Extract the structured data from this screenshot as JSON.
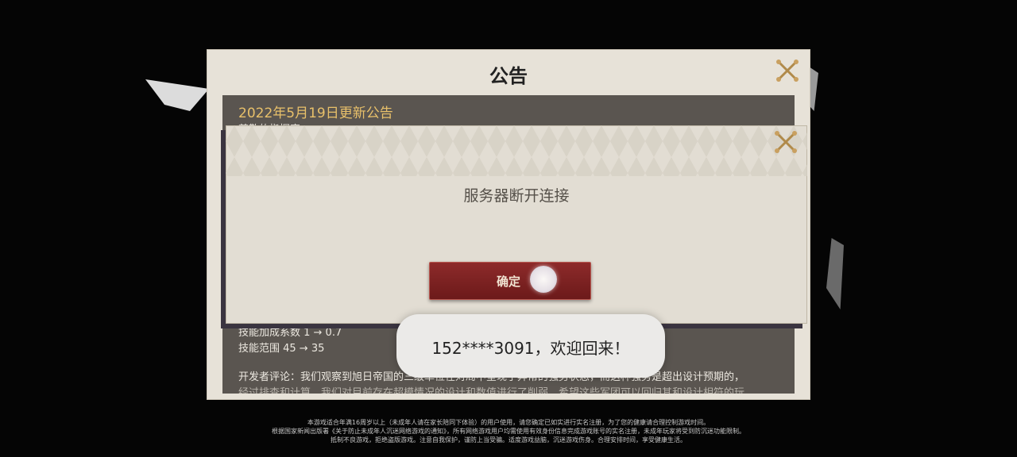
{
  "announcement": {
    "title": "公告",
    "date_heading": "2022年5月19日更新公告",
    "greeting": "尊敬的指挥官：",
    "lines": [
      "技能加成系数 1 → 0.7",
      "技能范围 45 → 35",
      "开发者评论：我们观察到旭日帝国的三级单位在对局中呈现了异常的强势状态，而这种强势是超出设计预期的，",
      "经过排查和计算，我们对目前存在超模情况的设计和数值进行了削弱，希望这些军团可以回归其和设计相符的玩"
    ]
  },
  "dialog": {
    "message": "服务器断开连接",
    "confirm_label": "确定"
  },
  "toast": {
    "text": "152****3091，欢迎回来！"
  },
  "footer": {
    "lines": [
      "本游戏适合年满16周岁以上（未成年人请在家长陪同下体验）的用户使用，请您确定已如实进行实名注册，为了您的健康请合理控制游戏时间。",
      "根据国家新闻出版署《关于防止未成年人沉迷网络游戏的通知》，所有网络游戏用户均需使用有效身份信息完成游戏账号的实名注册，未成年玩家将受到防沉迷功能限制。",
      "抵制不良游戏，拒绝盗版游戏。注意自我保护，谨防上当受骗。适度游戏益脑，沉迷游戏伤身。合理安排时间，享受健康生活。"
    ]
  },
  "colors": {
    "accent_gold": "#e8c06a",
    "button_red": "#7a2020",
    "panel_bg": "#e7e2d8"
  }
}
